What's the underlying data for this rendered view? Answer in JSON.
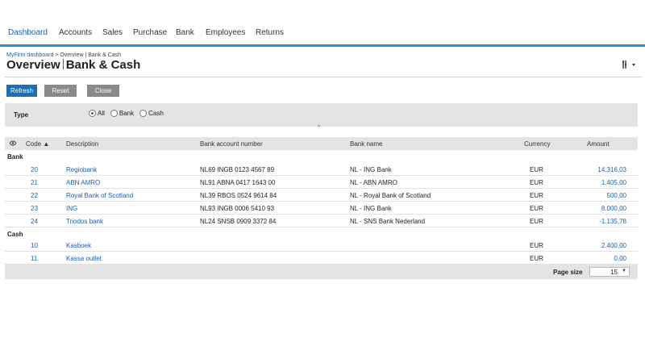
{
  "nav": {
    "tabs": [
      {
        "label": "Dashboard"
      },
      {
        "label": "Accounts"
      },
      {
        "label": "Sales"
      },
      {
        "label": "Purchase"
      },
      {
        "label": "Bank"
      },
      {
        "label": "Employees"
      },
      {
        "label": "Returns"
      }
    ]
  },
  "breadcrumb": {
    "root": "MyFirm dashboard",
    "sep": " > ",
    "current": "Overview | Bank & Cash"
  },
  "title": {
    "left": "Overview",
    "right": "Bank & Cash"
  },
  "toolbar": {
    "refresh": "Refresh",
    "reset": "Reset",
    "close": "Close"
  },
  "filter": {
    "label": "Type",
    "options": [
      {
        "label": "All",
        "selected": true
      },
      {
        "label": "Bank",
        "selected": false
      },
      {
        "label": "Cash",
        "selected": false
      }
    ]
  },
  "table": {
    "columns": {
      "code": "Code ▲",
      "description": "Description",
      "account": "Bank account number",
      "bank": "Bank name",
      "currency": "Currency",
      "amount": "Amount"
    },
    "groups": [
      {
        "name": "Bank",
        "rows": [
          {
            "code": "20",
            "description": "Regiobank",
            "account": "NL69 INGB 0123 4567 89",
            "bank": "NL - ING Bank",
            "currency": "EUR",
            "amount": "14.316,03"
          },
          {
            "code": "21",
            "description": "ABN AMRO",
            "account": "NL91 ABNA 0417 1643 00",
            "bank": "NL - ABN AMRO",
            "currency": "EUR",
            "amount": "1.405,00"
          },
          {
            "code": "22",
            "description": "Royal Bank of Scotland",
            "account": "NL39 RBOS 0524 9614 84",
            "bank": "NL - Royal Bank of Scotland",
            "currency": "EUR",
            "amount": "500,00"
          },
          {
            "code": "23",
            "description": "ING",
            "account": "NL93 INGB 0006 5410 93",
            "bank": "NL - ING Bank",
            "currency": "EUR",
            "amount": "8.000,00"
          },
          {
            "code": "24",
            "description": "Triodos bank",
            "account": "NL24 SNSB 0909 3372 84",
            "bank": "NL - SNS Bank Nederland",
            "currency": "EUR",
            "amount": "-1.135,78"
          }
        ]
      },
      {
        "name": "Cash",
        "rows": [
          {
            "code": "10",
            "description": "Kasboek",
            "account": "",
            "bank": "",
            "currency": "EUR",
            "amount": "2.400,00"
          },
          {
            "code": "11",
            "description": "Kassa outlet",
            "account": "",
            "bank": "",
            "currency": "EUR",
            "amount": "0,00"
          }
        ]
      }
    ]
  },
  "pager": {
    "label": "Page size",
    "value": "15"
  },
  "colors": {
    "accent": "#2f8fd6",
    "link": "#1a5fb4",
    "primary_button": "#1a6fb5",
    "secondary_button": "#8a8a8a",
    "panel": "#e4e4e4"
  }
}
